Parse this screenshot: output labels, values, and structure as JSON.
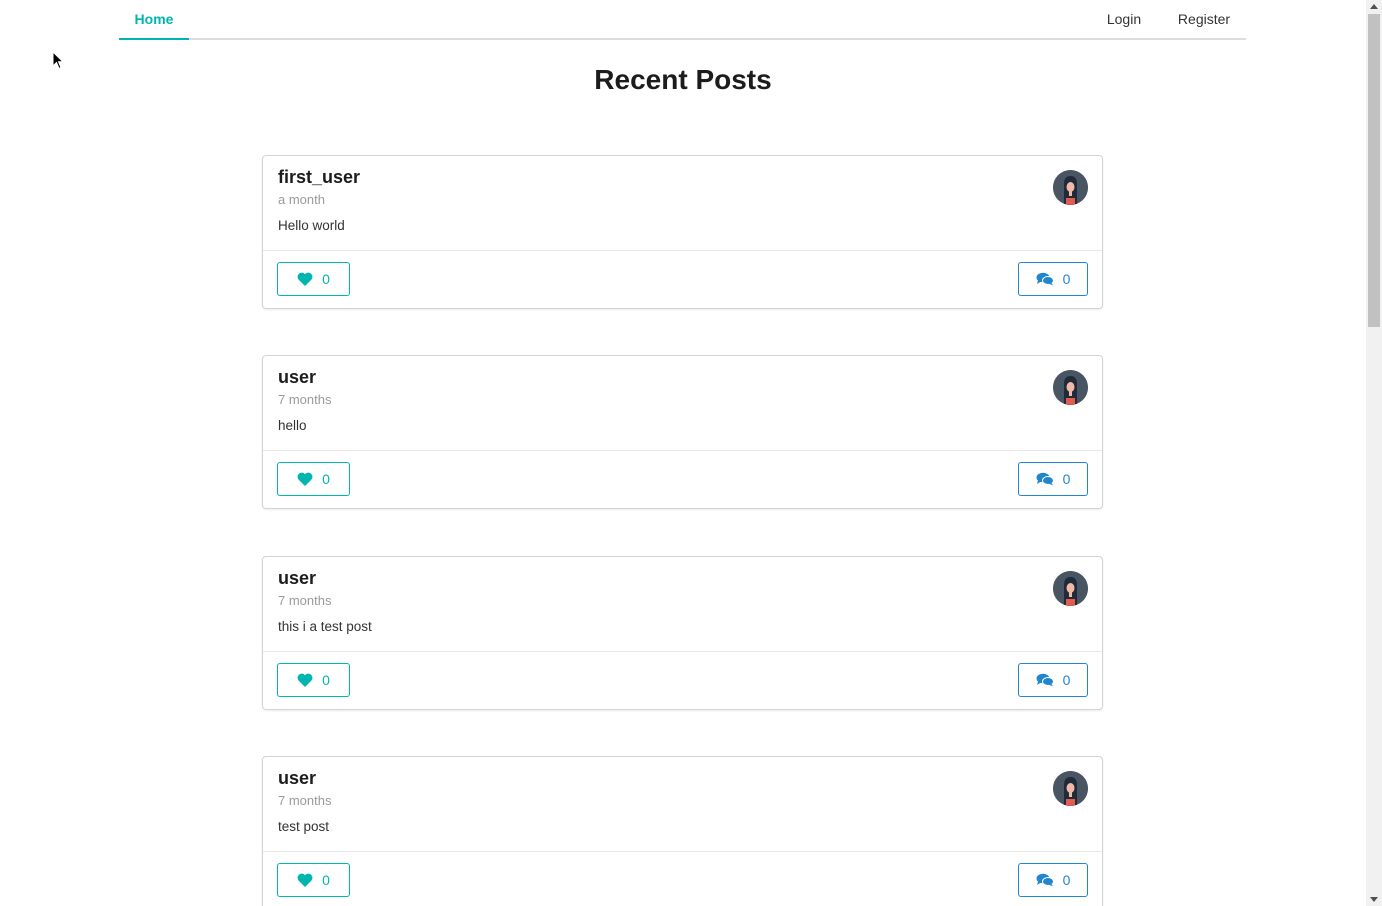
{
  "nav": {
    "home_label": "Home",
    "login_label": "Login",
    "register_label": "Register",
    "accent_color": "#00b5ad"
  },
  "page_title": "Recent Posts",
  "posts": [
    {
      "author": "first_user",
      "time": "a month",
      "text": "Hello world",
      "likes": "0",
      "comments": "0"
    },
    {
      "author": "user",
      "time": "7 months",
      "text": "hello",
      "likes": "0",
      "comments": "0"
    },
    {
      "author": "user",
      "time": "7 months",
      "text": "this i a test post",
      "likes": "0",
      "comments": "0"
    },
    {
      "author": "user",
      "time": "7 months",
      "text": "test post",
      "likes": "0",
      "comments": "0"
    }
  ],
  "icons": {
    "like": "heart-icon",
    "comment": "comments-icon",
    "avatar": "user-avatar"
  },
  "colors": {
    "like": "#00b5ad",
    "comment": "#2185d0",
    "avatar_bg": "#4a5563"
  }
}
